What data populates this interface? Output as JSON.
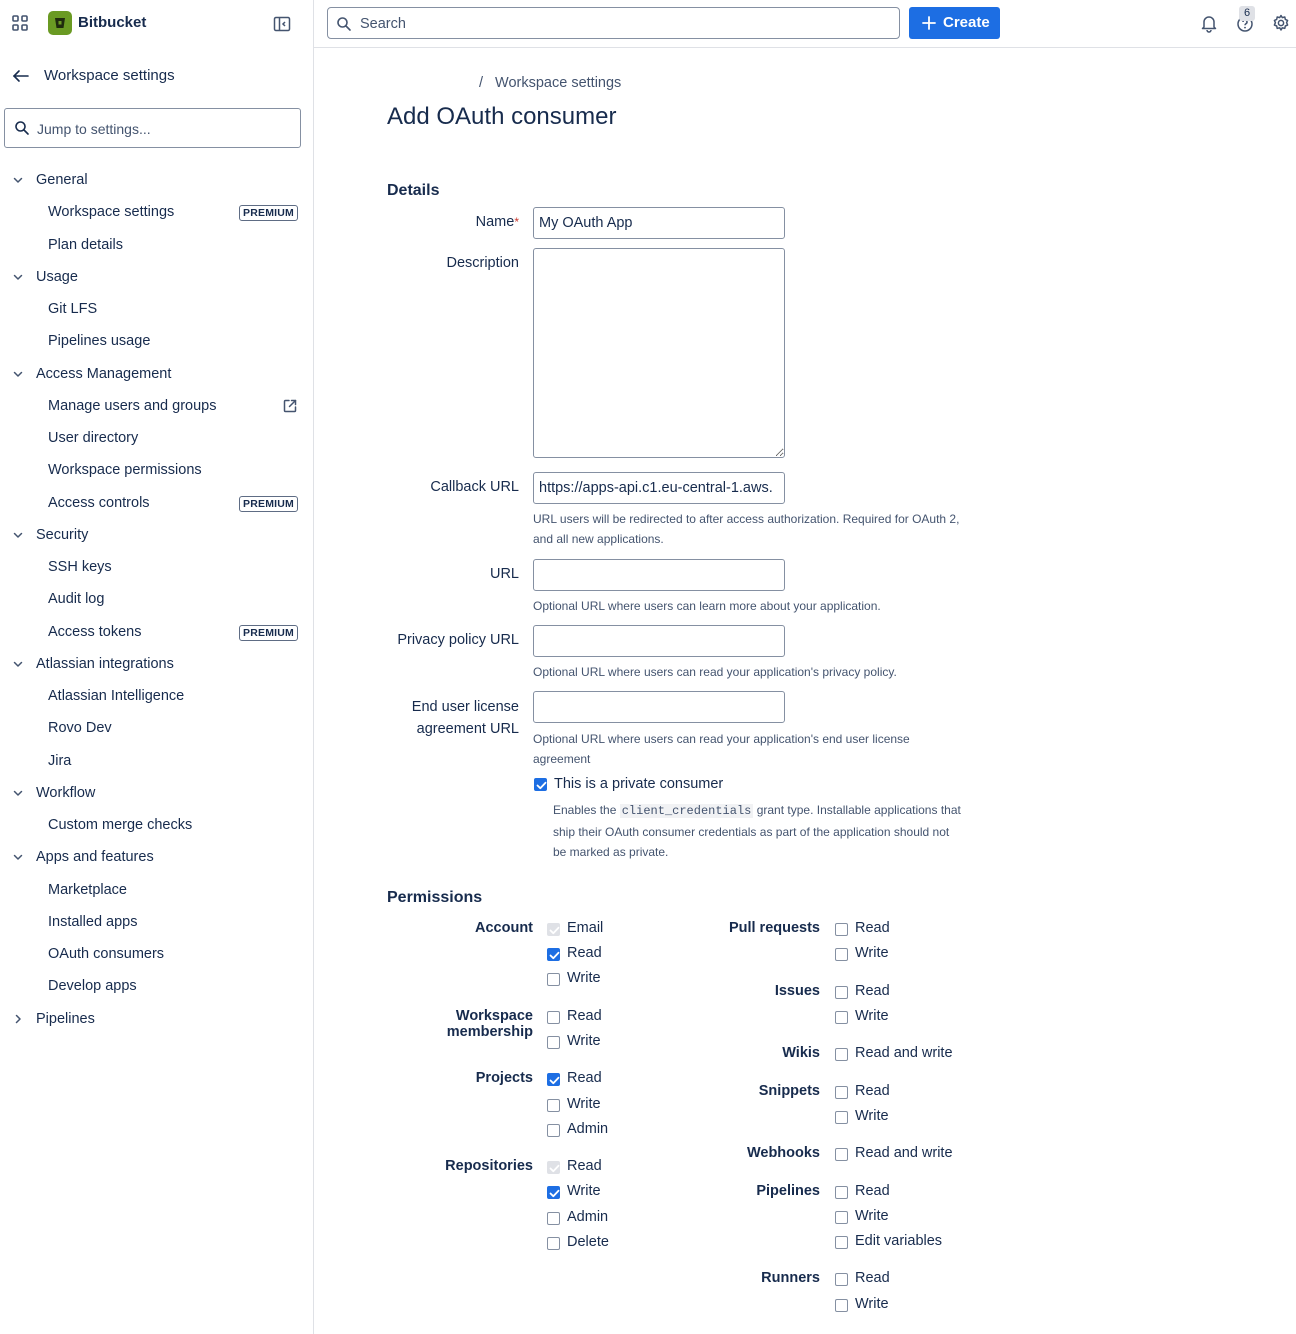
{
  "app": {
    "name": "Bitbucket"
  },
  "sidebar": {
    "back_label": "Workspace settings",
    "jump_placeholder": "Jump to settings...",
    "sections": [
      {
        "label": "General",
        "expanded": true,
        "items": [
          {
            "label": "Workspace settings",
            "badge": "PREMIUM"
          },
          {
            "label": "Plan details"
          }
        ]
      },
      {
        "label": "Usage",
        "expanded": true,
        "items": [
          {
            "label": "Git LFS"
          },
          {
            "label": "Pipelines usage"
          }
        ]
      },
      {
        "label": "Access Management",
        "expanded": true,
        "items": [
          {
            "label": "Manage users and groups",
            "external": true
          },
          {
            "label": "User directory"
          },
          {
            "label": "Workspace permissions"
          },
          {
            "label": "Access controls",
            "badge": "PREMIUM"
          }
        ]
      },
      {
        "label": "Security",
        "expanded": true,
        "items": [
          {
            "label": "SSH keys"
          },
          {
            "label": "Audit log"
          },
          {
            "label": "Access tokens",
            "badge": "PREMIUM"
          }
        ]
      },
      {
        "label": "Atlassian integrations",
        "expanded": true,
        "items": [
          {
            "label": "Atlassian Intelligence"
          },
          {
            "label": "Rovo Dev"
          },
          {
            "label": "Jira"
          }
        ]
      },
      {
        "label": "Workflow",
        "expanded": true,
        "items": [
          {
            "label": "Custom merge checks"
          }
        ]
      },
      {
        "label": "Apps and features",
        "expanded": true,
        "items": [
          {
            "label": "Marketplace"
          },
          {
            "label": "Installed apps"
          },
          {
            "label": "OAuth consumers"
          },
          {
            "label": "Develop apps"
          }
        ]
      },
      {
        "label": "Pipelines",
        "expanded": false,
        "items": []
      }
    ]
  },
  "topbar": {
    "search_placeholder": "Search",
    "create_label": "Create",
    "help_badge": "6"
  },
  "main": {
    "breadcrumb_sep": "/",
    "breadcrumb": "Workspace settings",
    "title": "Add OAuth consumer",
    "details_heading": "Details",
    "form": {
      "name_label": "Name",
      "name_required": "*",
      "name_value": "My OAuth App",
      "description_label": "Description",
      "callback_label": "Callback URL",
      "callback_value": "https://apps-api.c1.eu-central-1.aws.",
      "callback_help_1": "URL users will be redirected to after access authorization. Required for OAuth 2,",
      "callback_help_2": "and all new applications.",
      "url_label": "URL",
      "url_help": "Optional URL where users can learn more about your application.",
      "privacy_label": "Privacy policy URL",
      "privacy_help": "Optional URL where users can read your application's privacy policy.",
      "eula_label_1": "End user license",
      "eula_label_2": "agreement URL",
      "eula_help_1": "Optional URL where users can read your application's end user license",
      "eula_help_2": "agreement",
      "private_label": "This is a private consumer",
      "private_checked": true,
      "private_desc_pre": "Enables the",
      "private_desc_code": "client_credentials",
      "private_desc_post": "grant type. Installable applications that",
      "private_desc_2": "ship their OAuth consumer credentials as part of the application should not",
      "private_desc_3": "be marked as private."
    },
    "permissions_heading": "Permissions",
    "permissions_left": [
      {
        "group": "Account",
        "options": [
          {
            "label": "Email",
            "state": "disabled"
          },
          {
            "label": "Read",
            "state": "checked"
          },
          {
            "label": "Write",
            "state": "unchecked"
          }
        ]
      },
      {
        "group_1": "Workspace",
        "group_2": "membership",
        "options": [
          {
            "label": "Read",
            "state": "unchecked"
          },
          {
            "label": "Write",
            "state": "unchecked"
          }
        ]
      },
      {
        "group": "Projects",
        "options": [
          {
            "label": "Read",
            "state": "checked"
          },
          {
            "label": "Write",
            "state": "unchecked"
          },
          {
            "label": "Admin",
            "state": "unchecked"
          }
        ]
      },
      {
        "group": "Repositories",
        "options": [
          {
            "label": "Read",
            "state": "disabled"
          },
          {
            "label": "Write",
            "state": "checked"
          },
          {
            "label": "Admin",
            "state": "unchecked"
          },
          {
            "label": "Delete",
            "state": "unchecked"
          }
        ]
      }
    ],
    "permissions_right": [
      {
        "group": "Pull requests",
        "options": [
          {
            "label": "Read",
            "state": "unchecked"
          },
          {
            "label": "Write",
            "state": "unchecked"
          }
        ]
      },
      {
        "group": "Issues",
        "options": [
          {
            "label": "Read",
            "state": "unchecked"
          },
          {
            "label": "Write",
            "state": "unchecked"
          }
        ]
      },
      {
        "group": "Wikis",
        "options": [
          {
            "label": "Read and write",
            "state": "unchecked"
          }
        ]
      },
      {
        "group": "Snippets",
        "options": [
          {
            "label": "Read",
            "state": "unchecked"
          },
          {
            "label": "Write",
            "state": "unchecked"
          }
        ]
      },
      {
        "group": "Webhooks",
        "options": [
          {
            "label": "Read and write",
            "state": "unchecked"
          }
        ]
      },
      {
        "group": "Pipelines",
        "options": [
          {
            "label": "Read",
            "state": "unchecked"
          },
          {
            "label": "Write",
            "state": "unchecked"
          },
          {
            "label": "Edit variables",
            "state": "unchecked"
          }
        ]
      },
      {
        "group": "Runners",
        "options": [
          {
            "label": "Read",
            "state": "unchecked"
          },
          {
            "label": "Write",
            "state": "unchecked"
          }
        ]
      }
    ]
  },
  "colors": {
    "accent": "#1d6ee3",
    "brand": "#6a9a23",
    "text": "#172b4d",
    "subtle": "#44546f"
  },
  "icons": [
    "app-switcher-icon",
    "bitbucket-logo-icon",
    "sidebar-collapse-icon",
    "arrow-left-icon",
    "search-icon",
    "chevron-down-icon",
    "chevron-right-icon",
    "external-link-icon",
    "plus-icon",
    "bell-icon",
    "help-icon",
    "gear-icon",
    "checkmark-icon"
  ]
}
